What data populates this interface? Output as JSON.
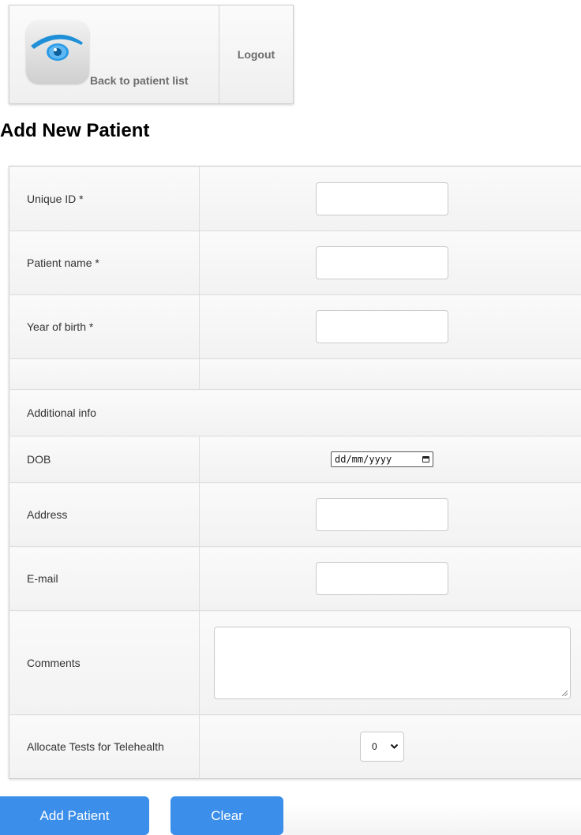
{
  "nav": {
    "back_label": "Back to patient list",
    "logout_label": "Logout",
    "app_icon": "eye-icon"
  },
  "page_title": "Add New Patient",
  "form": {
    "unique_id_label": "Unique ID *",
    "unique_id_value": "",
    "patient_name_label": "Patient name *",
    "patient_name_value": "",
    "year_of_birth_label": "Year of birth *",
    "year_of_birth_value": "",
    "additional_info_label": "Additional info",
    "dob_label": "DOB",
    "dob_placeholder": "dd/mm/yyyy",
    "address_label": "Address",
    "address_value": "",
    "email_label": "E-mail",
    "email_value": "",
    "comments_label": "Comments",
    "comments_value": "",
    "telehealth_label": "Allocate Tests for Telehealth",
    "telehealth_value": "0"
  },
  "buttons": {
    "add_patient": "Add Patient",
    "clear": "Clear"
  },
  "colors": {
    "accent": "#3b8eea",
    "eye_blue": "#1f8fd8"
  }
}
